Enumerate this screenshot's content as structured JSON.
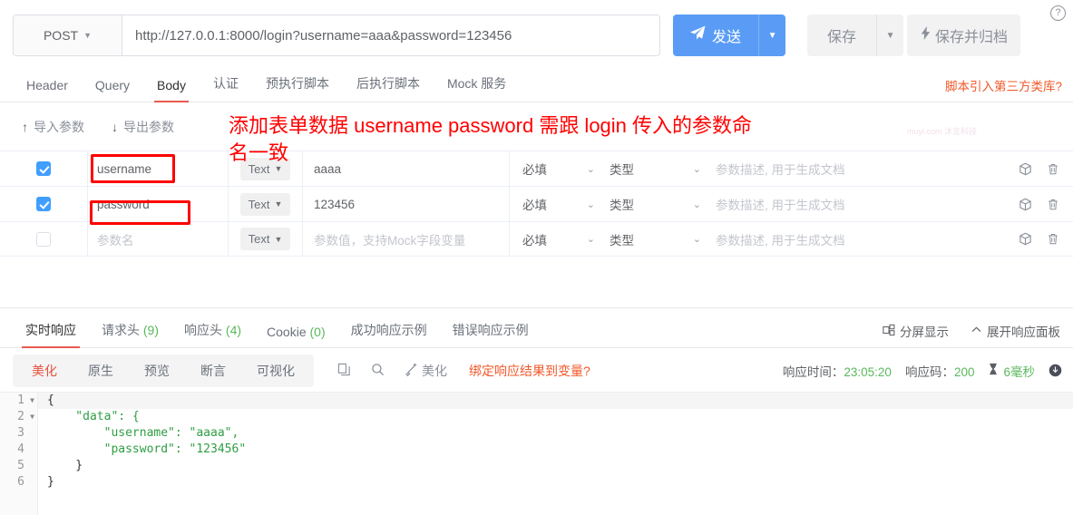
{
  "request": {
    "method": "POST",
    "url": "http://127.0.0.1:8000/login?username=aaa&password=123456",
    "send_label": "发送",
    "save_label": "保存",
    "archive_label": "保存并归档",
    "help_icon": "question-circle-icon",
    "send_icon": "paper-plane-icon",
    "archive_icon": "lightning-icon",
    "caret": "▾"
  },
  "tabs": [
    {
      "label": "Header",
      "active": false
    },
    {
      "label": "Query",
      "active": false
    },
    {
      "label": "Body",
      "active": true
    },
    {
      "label": "认证",
      "active": false
    },
    {
      "label": "预执行脚本",
      "active": false
    },
    {
      "label": "后执行脚本",
      "active": false
    },
    {
      "label": "Mock 服务",
      "active": false
    }
  ],
  "third_party_link": "脚本引入第三方类库?",
  "param_toolbar": {
    "import_label": "导入参数",
    "export_label": "导出参数",
    "import_icon": "arrow-up-icon",
    "export_icon": "arrow-down-icon"
  },
  "param_table": {
    "type_default": "Text",
    "required_label": "必填",
    "ptype_label": "类型",
    "name_placeholder": "参数名",
    "value_placeholder": "参数值，支持Mock字段变量",
    "desc_placeholder": "参数描述, 用于生成文档",
    "rows": [
      {
        "checked": true,
        "name": "username",
        "name_is_placeholder": false,
        "type": "Text",
        "value": "aaaa",
        "value_is_placeholder": false
      },
      {
        "checked": true,
        "name": "password",
        "name_is_placeholder": false,
        "type": "Text",
        "value": "123456",
        "value_is_placeholder": false
      },
      {
        "checked": false,
        "name": "参数名",
        "name_is_placeholder": true,
        "type": "Text",
        "value": "参数值，支持Mock字段变量",
        "value_is_placeholder": true
      }
    ]
  },
  "response_tabs": [
    {
      "label": "实时响应",
      "count": "",
      "active": true
    },
    {
      "label": "请求头",
      "count": "(9)",
      "active": false
    },
    {
      "label": "响应头",
      "count": "(4)",
      "active": false
    },
    {
      "label": "Cookie",
      "count": "(0)",
      "active": false
    },
    {
      "label": "成功响应示例",
      "count": "",
      "active": false
    },
    {
      "label": "错误响应示例",
      "count": "",
      "active": false
    }
  ],
  "response_tabs_right": [
    {
      "label": "分屏显示",
      "icon": "split-screen-icon"
    },
    {
      "label": "展开响应面板",
      "icon": "chevron-up-icon"
    }
  ],
  "response_toolbar": {
    "segments": [
      {
        "label": "美化",
        "active": true
      },
      {
        "label": "原生",
        "active": false
      },
      {
        "label": "预览",
        "active": false
      },
      {
        "label": "断言",
        "active": false
      },
      {
        "label": "可视化",
        "active": false
      }
    ],
    "copy_icon": "copy-icon",
    "search_icon": "search-icon",
    "beautify_icon": "magic-wand-icon",
    "beautify_label": "美化",
    "bind_link": "绑定响应结果到变量?",
    "time_label": "响应时间：",
    "time_value": "23:05:20",
    "code_label": "响应码：",
    "code_value": "200",
    "duration_icon": "hourglass-icon",
    "duration_value": "6毫秒",
    "download_icon": "download-circle-icon"
  },
  "code_viewer": {
    "lines": [
      {
        "n": "1",
        "fold": true,
        "text": "{"
      },
      {
        "n": "2",
        "fold": true,
        "text": "    \"data\": {"
      },
      {
        "n": "3",
        "fold": false,
        "text": "        \"username\": \"aaaa\","
      },
      {
        "n": "4",
        "fold": false,
        "text": "        \"password\": \"123456\""
      },
      {
        "n": "5",
        "fold": false,
        "text": "    }"
      },
      {
        "n": "6",
        "fold": false,
        "text": "}"
      }
    ]
  },
  "annotations": {
    "line1": "添加表单数据  username password 需跟 login 传入的参数命",
    "line2": "名一致",
    "color": "#ff0000"
  },
  "watermark": "muyi.com 沐言科技"
}
